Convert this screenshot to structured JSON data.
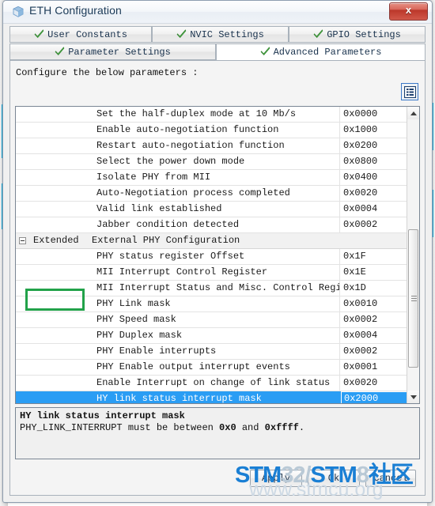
{
  "window": {
    "title": "ETH Configuration",
    "icon": "cube-icon",
    "close_label": "x"
  },
  "tabs": {
    "row1": [
      {
        "label": "User Constants",
        "icon": "green-check-icon",
        "active": false
      },
      {
        "label": "NVIC Settings",
        "icon": "green-check-icon",
        "active": false
      },
      {
        "label": "GPIO Settings",
        "icon": "green-check-icon",
        "active": false
      }
    ],
    "row2": [
      {
        "label": "Parameter Settings",
        "icon": "green-check-icon",
        "active": false
      },
      {
        "label": "Advanced Parameters",
        "icon": "green-check-icon",
        "active": true
      }
    ]
  },
  "pane": {
    "instruction": "Configure the below parameters :",
    "view_toggle_icon": "list-view-icon"
  },
  "table": {
    "rows": [
      {
        "type": "item",
        "name": "Set the half-duplex mode at 10 Mb/s",
        "value": "0x0000"
      },
      {
        "type": "item",
        "name": "Enable auto-negotiation function",
        "value": "0x1000"
      },
      {
        "type": "item",
        "name": "Restart auto-negotiation function",
        "value": "0x0200"
      },
      {
        "type": "item",
        "name": "Select the power down mode",
        "value": "0x0800"
      },
      {
        "type": "item",
        "name": "Isolate PHY from MII",
        "value": "0x0400"
      },
      {
        "type": "item",
        "name": "Auto-Negotiation process completed",
        "value": "0x0020"
      },
      {
        "type": "item",
        "name": "Valid link established",
        "value": "0x0004"
      },
      {
        "type": "item",
        "name": "Jabber condition detected",
        "value": "0x0002"
      },
      {
        "type": "group",
        "name": "Extended",
        "desc": "External PHY Configuration",
        "value": ""
      },
      {
        "type": "item",
        "name": "PHY status register Offset",
        "value": "0x1F"
      },
      {
        "type": "item",
        "name": "MII Interrupt Control Register",
        "value": "0x1E"
      },
      {
        "type": "item",
        "name": "MII Interrupt Status and Misc. Control Register",
        "value": "0x1D"
      },
      {
        "type": "item",
        "name": "PHY Link mask",
        "value": "0x0010"
      },
      {
        "type": "item",
        "name": "PHY Speed mask",
        "value": "0x0002"
      },
      {
        "type": "item",
        "name": "PHY Duplex mask",
        "value": "0x0004"
      },
      {
        "type": "item",
        "name": "PHY Enable interrupts",
        "value": "0x0002"
      },
      {
        "type": "item",
        "name": "PHY Enable output interrupt events",
        "value": "0x0001"
      },
      {
        "type": "item",
        "name": "Enable Interrupt on change of link status",
        "value": "0x0020"
      },
      {
        "type": "item",
        "name": "HY link status interrupt mask",
        "value": "0x2000",
        "selected": true
      }
    ]
  },
  "description": {
    "title": "HY link status interrupt mask",
    "prefix": "PHY_LINK_INTERRUPT must be between ",
    "min": "0x0",
    "middle": " and ",
    "max": "0xffff",
    "suffix": "."
  },
  "buttons": [
    {
      "label": "Apply"
    },
    {
      "label": "Ok"
    },
    {
      "label": "Cancel"
    }
  ],
  "watermark": {
    "part1": "STM",
    "part2": "32/",
    "part3": "STM",
    "part4": "8",
    "part5": "社区",
    "sub": "www.stmcu.org"
  },
  "annotation": {
    "target": "Extended",
    "color": "#22a24a"
  },
  "colors": {
    "selection": "#2a9df4",
    "accent": "#1ab5e8",
    "annotation": "#22a24a",
    "title_text": "#1b3a57"
  }
}
